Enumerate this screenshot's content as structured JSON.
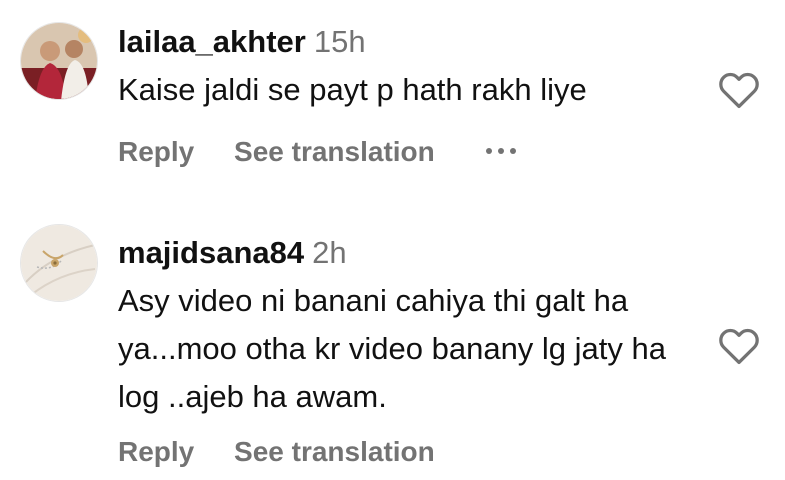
{
  "comments": [
    {
      "username": "lailaa_akhter",
      "time": "15h",
      "text": "Kaise jaldi se payt p hath rakh liye",
      "reply_label": "Reply",
      "translate_label": "See translation",
      "more_icon": "ellipsis-icon",
      "like_icon": "heart-outline-icon"
    },
    {
      "username": "majidsana84",
      "time": "2h",
      "text": "Asy video ni banani cahiya thi galt ha ya...moo otha kr video banany lg jaty ha log ..ajeb ha awam.",
      "reply_label": "Reply",
      "translate_label": "See translation",
      "like_icon": "heart-outline-icon"
    }
  ]
}
